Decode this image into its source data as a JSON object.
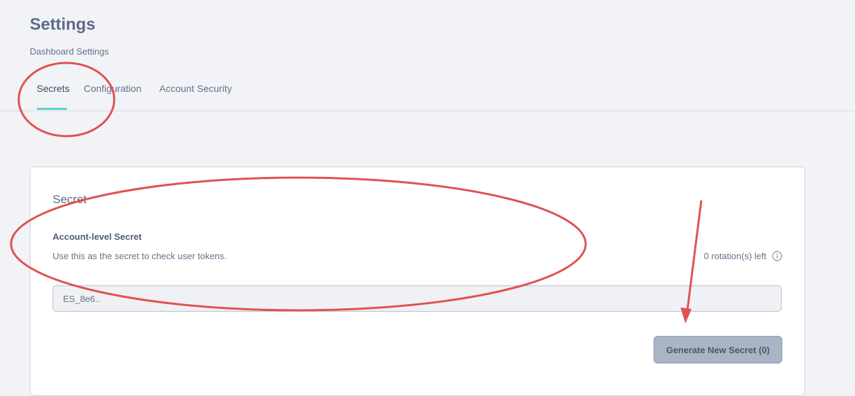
{
  "header": {
    "title": "Settings",
    "subtitle": "Dashboard Settings"
  },
  "tabs": [
    {
      "label": "Secrets",
      "active": true
    },
    {
      "label": "Configuration",
      "active": false
    },
    {
      "label": "Account Security",
      "active": false
    }
  ],
  "card": {
    "title": "Secret",
    "section_label": "Account-level Secret",
    "section_description": "Use this as the secret to check user tokens.",
    "rotations_left": "0 rotation(s) left",
    "secret_value": "ES_8e6..",
    "generate_button_label": "Generate New Secret (0)"
  },
  "icons": {
    "info": "info-icon"
  },
  "colors": {
    "background": "#f2f3f7",
    "active_tab_underline": "#5ad0c8",
    "button_background": "#a9b4c4",
    "annotation": "#e05252"
  }
}
